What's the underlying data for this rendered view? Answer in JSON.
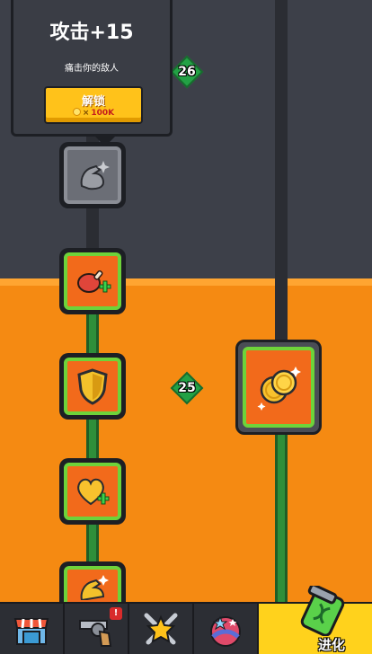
{
  "tooltip": {
    "title": "攻击+15",
    "description": "痛击你的敌人",
    "unlock_label": "解锁",
    "cost_multiplier": "×",
    "cost_value": "100K"
  },
  "badges": {
    "upper": "26",
    "lower": "25"
  },
  "tabs": [
    {
      "icon": "shop-icon",
      "alert": ""
    },
    {
      "icon": "revolver-icon",
      "alert": "!"
    },
    {
      "icon": "crossed-swords-star-icon",
      "alert": ""
    },
    {
      "icon": "planet-stars-icon",
      "alert": ""
    },
    {
      "icon": "dna-canister-icon",
      "label": "进化"
    }
  ],
  "colors": {
    "orange_bg": "#f58a12",
    "dark_bg": "#3d4049",
    "node_orange": "#f26a1b",
    "node_border": "#6ed33a",
    "badge_green": "#23a145",
    "active_tab": "#ffd21c"
  }
}
